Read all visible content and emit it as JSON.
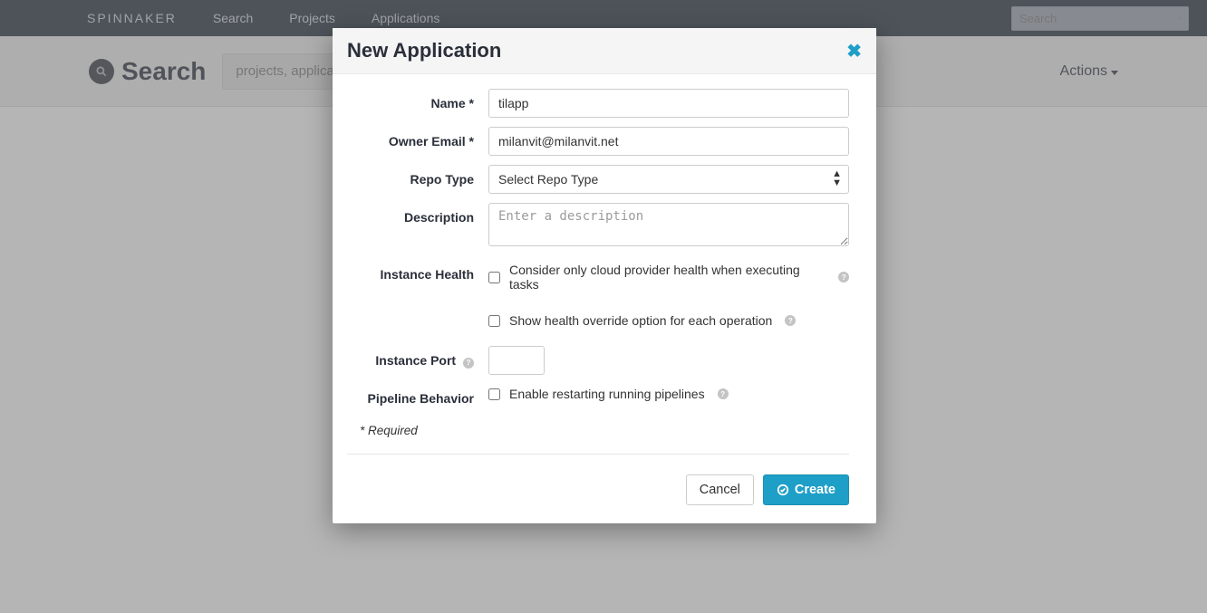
{
  "nav": {
    "brand": "SPINNAKER",
    "links": [
      "Search",
      "Projects",
      "Applications"
    ],
    "search_placeholder": "Search"
  },
  "subheader": {
    "title": "Search",
    "input_placeholder": "projects, applicat",
    "actions_label": "Actions"
  },
  "modal": {
    "title": "New Application",
    "fields": {
      "name_label": "Name *",
      "name_value": "tilapp",
      "email_label": "Owner Email *",
      "email_value": "milanvit@milanvit.net",
      "repo_label": "Repo Type",
      "repo_placeholder": "Select Repo Type",
      "desc_label": "Description",
      "desc_placeholder": "Enter a description",
      "health_label": "Instance Health",
      "health_opt1": "Consider only cloud provider health when executing tasks",
      "health_opt2": "Show health override option for each operation",
      "port_label": "Instance Port",
      "pipeline_label": "Pipeline Behavior",
      "pipeline_opt": "Enable restarting running pipelines"
    },
    "required_note": "* Required",
    "buttons": {
      "cancel": "Cancel",
      "create": "Create"
    }
  }
}
